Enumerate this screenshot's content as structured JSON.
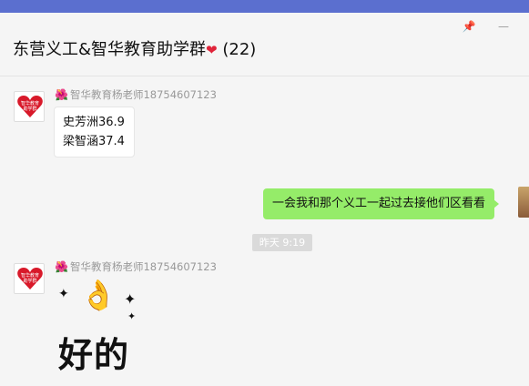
{
  "window": {
    "pin_icon": "pin-icon",
    "minimize_icon": "minimize-icon",
    "pin_glyph": "📌",
    "minimize_glyph": "—"
  },
  "chat": {
    "title": "东营义工&智华教育助学群",
    "title_emoji": "❤",
    "member_count": "(22)"
  },
  "messages": [
    {
      "sender": "智华教育杨老师18754607123",
      "sender_emoji": "🌺",
      "avatar_text": "智华教育助学群",
      "lines": [
        "史芳洲36.9",
        "梁智涵37.4"
      ]
    },
    {
      "self": true,
      "text": "一会我和那个义工一起过去接他们区看看"
    },
    {
      "sender": "智华教育杨老师18754607123",
      "sender_emoji": "🌺",
      "avatar_text": "智华教育助学群",
      "sticker_text": "好的",
      "sticker_hand": "👌",
      "sticker_sparkle": "✦"
    }
  ],
  "timestamp": "昨天 9:19",
  "colors": {
    "accent_strip": "#5b6fcf",
    "self_bubble": "#95ec69",
    "heart": "#d8192a"
  }
}
